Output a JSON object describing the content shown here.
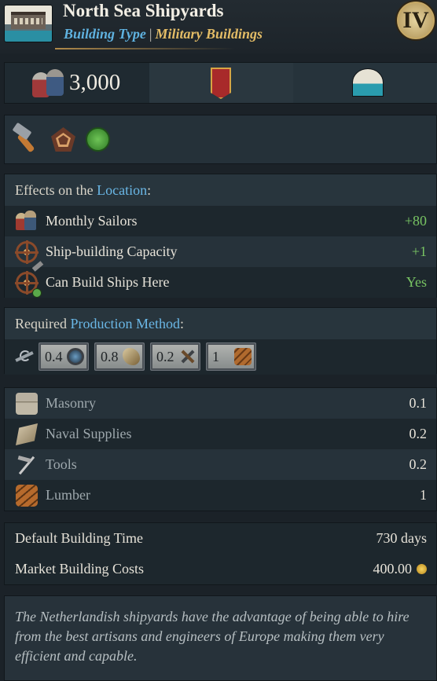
{
  "header": {
    "title": "North Sea Shipyards",
    "type_key": "Building Type",
    "type_value": "Military Buildings",
    "tier": "IV"
  },
  "stats": {
    "workers": "3,000"
  },
  "effects": {
    "heading_prefix": "Effects on the ",
    "heading_link": "Location",
    "heading_suffix": ":",
    "rows": [
      {
        "label": "Monthly Sailors",
        "value": "+80"
      },
      {
        "label": "Ship-building Capacity",
        "value": "+1"
      },
      {
        "label": "Can Build Ships Here",
        "value": "Yes"
      }
    ]
  },
  "production": {
    "heading_prefix": "Required ",
    "heading_link": "Production Method",
    "heading_suffix": ":",
    "chips": [
      "0.4",
      "0.8",
      "0.2",
      "1"
    ]
  },
  "inputs": [
    {
      "label": "Masonry",
      "value": "0.1"
    },
    {
      "label": "Naval Supplies",
      "value": "0.2"
    },
    {
      "label": "Tools",
      "value": "0.2"
    },
    {
      "label": "Lumber",
      "value": "1"
    }
  ],
  "costs": {
    "time_label": "Default Building Time",
    "time_value": "730 days",
    "market_label": "Market Building Costs",
    "market_value": "400.00"
  },
  "description": "The Netherlandish shipyards have the advantage of being able to hire from the best artisans and engineers of Europe making them very efficient and capable.",
  "colors": {
    "accent_blue": "#6ab7e6",
    "accent_gold": "#e3bc66",
    "positive_green": "#78c463"
  },
  "icons": [
    "shipyard-icon",
    "tier-medallion-icon",
    "workers-icon",
    "banner-icon",
    "port-icon",
    "hammer-icon",
    "pentagon-icon",
    "green-check-icon",
    "sailors-icon",
    "ship-wheel-icon",
    "spyglass-icon",
    "rope-icon",
    "tools-icon",
    "logs-icon",
    "masonry-icon",
    "naval-supplies-icon",
    "gold-coin-icon"
  ]
}
